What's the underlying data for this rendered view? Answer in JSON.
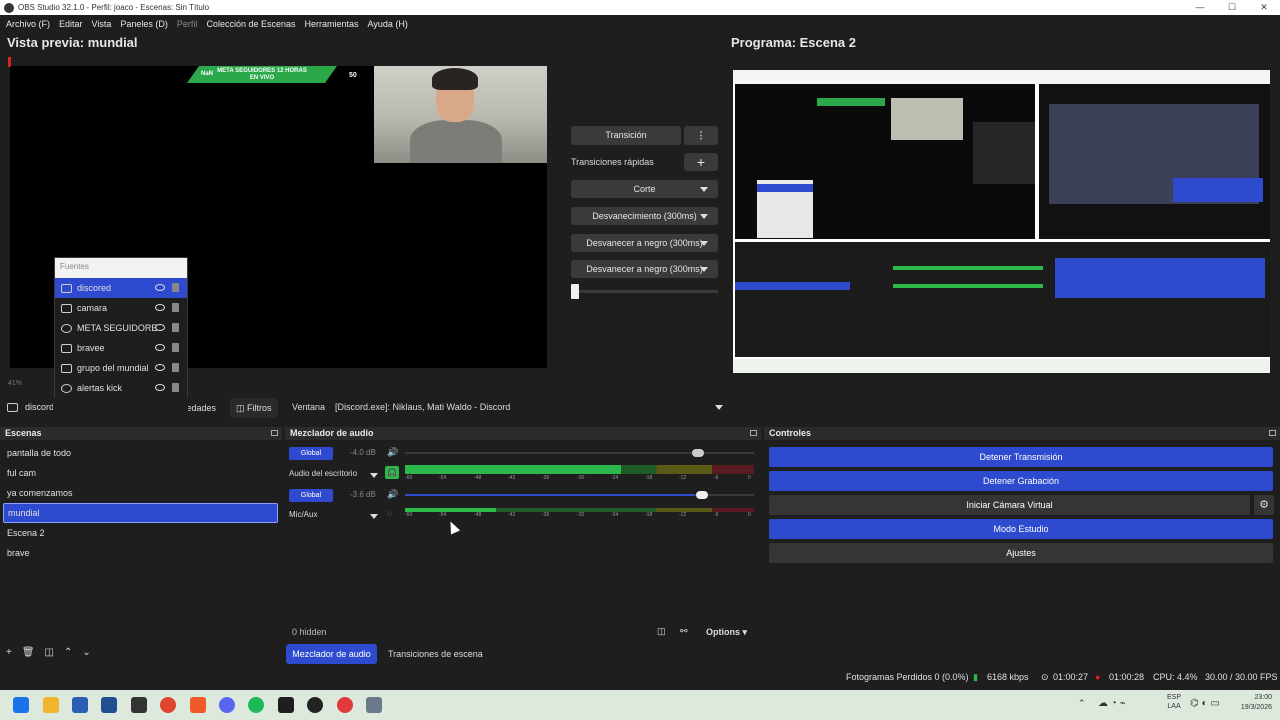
{
  "window": {
    "title": "OBS Studio 32.1.0 - Perfil: joaco - Escenas: Sin Título"
  },
  "menu": [
    "Archivo (F)",
    "Editar",
    "Vista",
    "Paneles (D)",
    "Perfil",
    "Colección de Escenas",
    "Herramientas",
    "Ayuda (H)"
  ],
  "preview": {
    "title": "Vista previa: mundial",
    "banner_line1": "META SEGUIDORES 12 HORAS",
    "banner_line2": "EN VIVO",
    "banner_nan": "NaN",
    "banner_count": "50",
    "zoom": "41%"
  },
  "program": {
    "title": "Programa: Escena 2"
  },
  "fuentes": {
    "header": "Fuentes",
    "items": [
      {
        "label": "discored",
        "selected": true,
        "icon": "window-icon"
      },
      {
        "label": "camara",
        "selected": false,
        "icon": "camera-icon"
      },
      {
        "label": "META SEGUIDORE",
        "selected": false,
        "icon": "browser-icon"
      },
      {
        "label": "bravee",
        "selected": false,
        "icon": "window-icon"
      },
      {
        "label": "grupo del mundial",
        "selected": false,
        "icon": "image-icon"
      },
      {
        "label": "alertas kick",
        "selected": false,
        "icon": "browser-icon"
      }
    ]
  },
  "transitions": {
    "transition_btn": "Transición",
    "quick_label": "Transiciones rápidas",
    "items": [
      "Corte",
      "Desvanecimiento (300ms)",
      "Desvanecer a negro (300ms)",
      "Desvanecer a negro (300ms)"
    ]
  },
  "source_toolbar": {
    "source_name": "discord",
    "properties": "Propiedades",
    "filters": "Filtros",
    "window_label": "Ventana",
    "window_value": "[Discord.exe]: Niklaus, Mati Waldo - Discord"
  },
  "scenes": {
    "title": "Escenas",
    "items": [
      "pantalla de todo",
      "ful cam",
      "ya comenzamos",
      "mundial",
      "Escena 2",
      "brave"
    ],
    "selected_index": 3
  },
  "mixer": {
    "title": "Mezclador de audio",
    "channels": [
      {
        "name": "Audio del escritorio",
        "badge": "Global",
        "db": "-4.0 dB",
        "level": 0.62,
        "volume": 0.84
      },
      {
        "name": "Mic/Aux",
        "badge": "Global",
        "db": "-3.6 dB",
        "level": 0.26,
        "volume": 0.85
      }
    ],
    "scale": [
      "-60",
      "-54",
      "-48",
      "-42",
      "-36",
      "-30",
      "-24",
      "-18",
      "-12",
      "-6",
      "0"
    ],
    "hidden": "0 hidden",
    "options": "Options",
    "tabs": [
      "Mezclador de audio",
      "Transiciones de escena"
    ]
  },
  "controls": {
    "title": "Controles",
    "buttons": [
      {
        "label": "Detener Transmisión",
        "active": true
      },
      {
        "label": "Detener Grabación",
        "active": true
      },
      {
        "label": "Iniciar Cámara Virtual",
        "active": false
      },
      {
        "label": "Modo Estudio",
        "active": true
      },
      {
        "label": "Ajustes",
        "active": false
      }
    ]
  },
  "status": {
    "dropped": "Fotogramas Perdidos 0 (0.0%)",
    "kbps": "6168 kbps",
    "stream_time": "01:00:27",
    "rec_time": "01:00:28",
    "cpu": "CPU: 4.4%",
    "fps": "30.00 / 30.00 FPS"
  },
  "taskbar": {
    "lang": "ESP",
    "lang2": "LAA",
    "time": "23:00",
    "date": "19/3/2026"
  },
  "colors": {
    "accent": "#2e4bcf",
    "meter_green": "#2db84b",
    "meter_yellow": "#8c8a1e",
    "meter_red": "#b42b3b"
  }
}
